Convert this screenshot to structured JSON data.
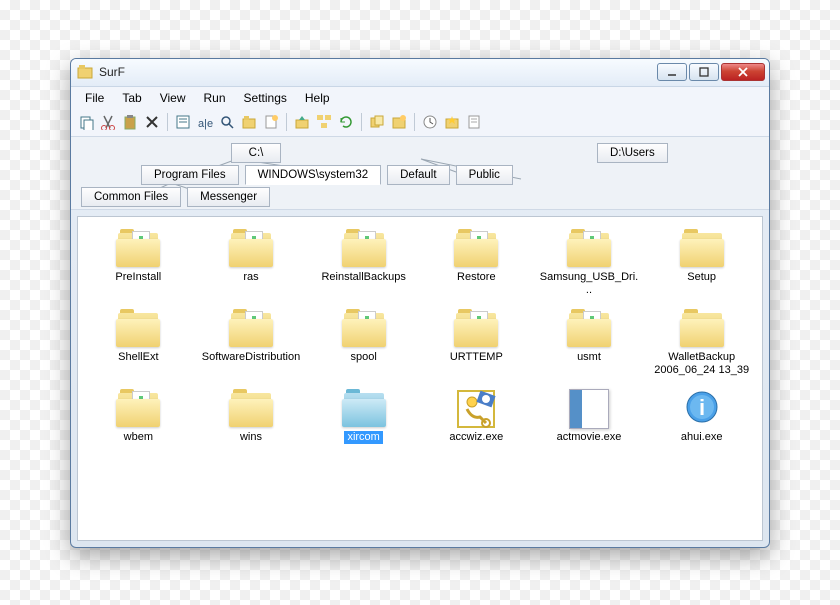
{
  "window": {
    "title": "SurF"
  },
  "menu": [
    "File",
    "Tab",
    "View",
    "Run",
    "Settings",
    "Help"
  ],
  "toolbar_icons": [
    "copy-icon",
    "cut-icon",
    "paste-icon",
    "delete-icon",
    "sep",
    "properties-icon",
    "rename-icon",
    "search-icon",
    "new-folder-icon",
    "new-file-icon",
    "sep",
    "folder-up-icon",
    "folder-tree-icon",
    "refresh-icon",
    "sep",
    "clone-tab-icon",
    "new-tab-icon",
    "sep",
    "history-icon",
    "fav-icon",
    "doc-icon"
  ],
  "tabs": {
    "row1": [
      {
        "label": "C:\\",
        "indent": 150,
        "active": false
      },
      {
        "label": "D:\\Users",
        "indent": 310,
        "active": false
      }
    ],
    "row2": [
      {
        "label": "Program Files",
        "indent": 60,
        "active": false
      },
      {
        "label": "WINDOWS\\system32",
        "indent": 0,
        "active": true
      },
      {
        "label": "Default",
        "indent": 0,
        "active": false
      },
      {
        "label": "Public",
        "indent": 0,
        "active": false
      }
    ],
    "row3": [
      {
        "label": "Common Files",
        "indent": 0,
        "active": false
      },
      {
        "label": "Messenger",
        "indent": 0,
        "active": false
      }
    ]
  },
  "items": [
    {
      "name": "PreInstall",
      "type": "folder-doc"
    },
    {
      "name": "ras",
      "type": "folder-doc"
    },
    {
      "name": "ReinstallBackups",
      "type": "folder-doc"
    },
    {
      "name": "Restore",
      "type": "folder-doc"
    },
    {
      "name": "Samsung_USB_Dri...",
      "type": "folder-doc"
    },
    {
      "name": "Setup",
      "type": "folder"
    },
    {
      "name": "ShellExt",
      "type": "folder"
    },
    {
      "name": "SoftwareDistribution",
      "type": "folder-doc"
    },
    {
      "name": "spool",
      "type": "folder-doc"
    },
    {
      "name": "URTTEMP",
      "type": "folder-doc"
    },
    {
      "name": "usmt",
      "type": "folder-doc"
    },
    {
      "name": "WalletBackup 2006_06_24 13_39",
      "type": "folder"
    },
    {
      "name": "wbem",
      "type": "folder-doc"
    },
    {
      "name": "wins",
      "type": "folder"
    },
    {
      "name": "xircom",
      "type": "folder-blue",
      "selected": true
    },
    {
      "name": "accwiz.exe",
      "type": "exe-accwiz"
    },
    {
      "name": "actmovie.exe",
      "type": "exe-actmovie"
    },
    {
      "name": "ahui.exe",
      "type": "exe-info"
    }
  ]
}
